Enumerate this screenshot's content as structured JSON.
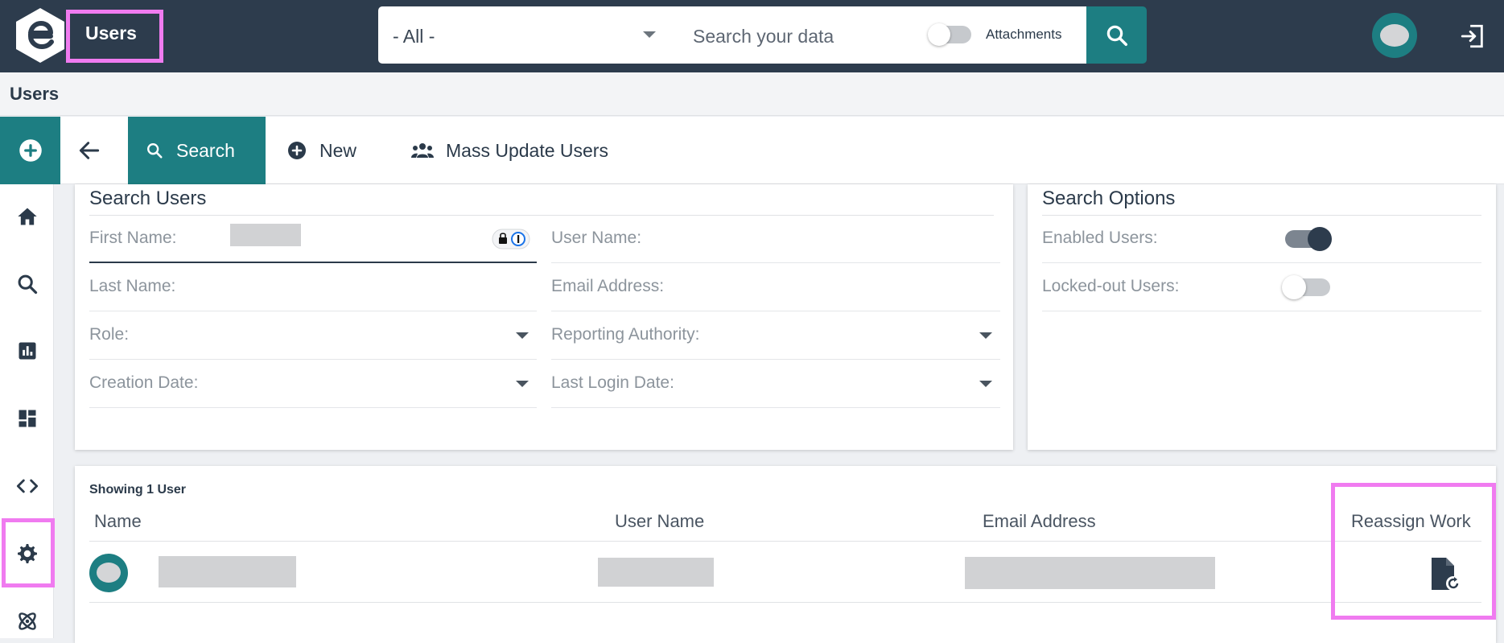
{
  "topbar": {
    "app_title": "Users",
    "scope_select": "- All -",
    "search_placeholder": "Search your data",
    "attachments_label": "Attachments",
    "attachments_on": false
  },
  "breadcrumb": "Users",
  "actionbar": {
    "search_label": "Search",
    "new_label": "New",
    "mass_update_label": "Mass Update Users"
  },
  "rail": [
    "home-icon",
    "search-icon",
    "reports-icon",
    "dashboard-icon",
    "code-icon",
    "gear-icon",
    "atom-icon"
  ],
  "search_users": {
    "title": "Search Users",
    "fields_left": [
      "First Name:",
      "Last Name:",
      "Role:",
      "Creation Date:"
    ],
    "fields_right": [
      "User Name:",
      "Email Address:",
      "Reporting Authority:",
      "Last Login Date:"
    ]
  },
  "search_options": {
    "title": "Search Options",
    "enabled_label": "Enabled Users:",
    "enabled_on": true,
    "locked_label": "Locked-out Users:",
    "locked_on": false
  },
  "results": {
    "showing": "Showing 1 User",
    "columns": [
      "Name",
      "User Name",
      "Email Address",
      "Reassign Work"
    ]
  },
  "colors": {
    "teal": "#1d7e82",
    "navy": "#2d3c4d",
    "highlight": "#f07bf0"
  }
}
